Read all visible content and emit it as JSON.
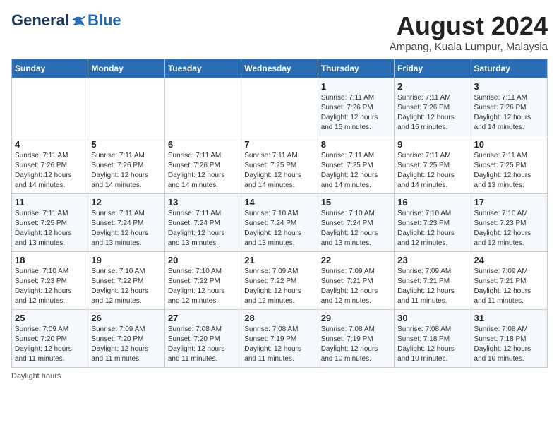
{
  "header": {
    "logo_general": "General",
    "logo_blue": "Blue",
    "month_year": "August 2024",
    "location": "Ampang, Kuala Lumpur, Malaysia"
  },
  "days_of_week": [
    "Sunday",
    "Monday",
    "Tuesday",
    "Wednesday",
    "Thursday",
    "Friday",
    "Saturday"
  ],
  "weeks": [
    [
      {
        "day": "",
        "info": ""
      },
      {
        "day": "",
        "info": ""
      },
      {
        "day": "",
        "info": ""
      },
      {
        "day": "",
        "info": ""
      },
      {
        "day": "1",
        "info": "Sunrise: 7:11 AM\nSunset: 7:26 PM\nDaylight: 12 hours\nand 15 minutes."
      },
      {
        "day": "2",
        "info": "Sunrise: 7:11 AM\nSunset: 7:26 PM\nDaylight: 12 hours\nand 15 minutes."
      },
      {
        "day": "3",
        "info": "Sunrise: 7:11 AM\nSunset: 7:26 PM\nDaylight: 12 hours\nand 14 minutes."
      }
    ],
    [
      {
        "day": "4",
        "info": "Sunrise: 7:11 AM\nSunset: 7:26 PM\nDaylight: 12 hours\nand 14 minutes."
      },
      {
        "day": "5",
        "info": "Sunrise: 7:11 AM\nSunset: 7:26 PM\nDaylight: 12 hours\nand 14 minutes."
      },
      {
        "day": "6",
        "info": "Sunrise: 7:11 AM\nSunset: 7:26 PM\nDaylight: 12 hours\nand 14 minutes."
      },
      {
        "day": "7",
        "info": "Sunrise: 7:11 AM\nSunset: 7:25 PM\nDaylight: 12 hours\nand 14 minutes."
      },
      {
        "day": "8",
        "info": "Sunrise: 7:11 AM\nSunset: 7:25 PM\nDaylight: 12 hours\nand 14 minutes."
      },
      {
        "day": "9",
        "info": "Sunrise: 7:11 AM\nSunset: 7:25 PM\nDaylight: 12 hours\nand 14 minutes."
      },
      {
        "day": "10",
        "info": "Sunrise: 7:11 AM\nSunset: 7:25 PM\nDaylight: 12 hours\nand 13 minutes."
      }
    ],
    [
      {
        "day": "11",
        "info": "Sunrise: 7:11 AM\nSunset: 7:25 PM\nDaylight: 12 hours\nand 13 minutes."
      },
      {
        "day": "12",
        "info": "Sunrise: 7:11 AM\nSunset: 7:24 PM\nDaylight: 12 hours\nand 13 minutes."
      },
      {
        "day": "13",
        "info": "Sunrise: 7:11 AM\nSunset: 7:24 PM\nDaylight: 12 hours\nand 13 minutes."
      },
      {
        "day": "14",
        "info": "Sunrise: 7:10 AM\nSunset: 7:24 PM\nDaylight: 12 hours\nand 13 minutes."
      },
      {
        "day": "15",
        "info": "Sunrise: 7:10 AM\nSunset: 7:24 PM\nDaylight: 12 hours\nand 13 minutes."
      },
      {
        "day": "16",
        "info": "Sunrise: 7:10 AM\nSunset: 7:23 PM\nDaylight: 12 hours\nand 12 minutes."
      },
      {
        "day": "17",
        "info": "Sunrise: 7:10 AM\nSunset: 7:23 PM\nDaylight: 12 hours\nand 12 minutes."
      }
    ],
    [
      {
        "day": "18",
        "info": "Sunrise: 7:10 AM\nSunset: 7:23 PM\nDaylight: 12 hours\nand 12 minutes."
      },
      {
        "day": "19",
        "info": "Sunrise: 7:10 AM\nSunset: 7:22 PM\nDaylight: 12 hours\nand 12 minutes."
      },
      {
        "day": "20",
        "info": "Sunrise: 7:10 AM\nSunset: 7:22 PM\nDaylight: 12 hours\nand 12 minutes."
      },
      {
        "day": "21",
        "info": "Sunrise: 7:09 AM\nSunset: 7:22 PM\nDaylight: 12 hours\nand 12 minutes."
      },
      {
        "day": "22",
        "info": "Sunrise: 7:09 AM\nSunset: 7:21 PM\nDaylight: 12 hours\nand 12 minutes."
      },
      {
        "day": "23",
        "info": "Sunrise: 7:09 AM\nSunset: 7:21 PM\nDaylight: 12 hours\nand 11 minutes."
      },
      {
        "day": "24",
        "info": "Sunrise: 7:09 AM\nSunset: 7:21 PM\nDaylight: 12 hours\nand 11 minutes."
      }
    ],
    [
      {
        "day": "25",
        "info": "Sunrise: 7:09 AM\nSunset: 7:20 PM\nDaylight: 12 hours\nand 11 minutes."
      },
      {
        "day": "26",
        "info": "Sunrise: 7:09 AM\nSunset: 7:20 PM\nDaylight: 12 hours\nand 11 minutes."
      },
      {
        "day": "27",
        "info": "Sunrise: 7:08 AM\nSunset: 7:20 PM\nDaylight: 12 hours\nand 11 minutes."
      },
      {
        "day": "28",
        "info": "Sunrise: 7:08 AM\nSunset: 7:19 PM\nDaylight: 12 hours\nand 11 minutes."
      },
      {
        "day": "29",
        "info": "Sunrise: 7:08 AM\nSunset: 7:19 PM\nDaylight: 12 hours\nand 10 minutes."
      },
      {
        "day": "30",
        "info": "Sunrise: 7:08 AM\nSunset: 7:18 PM\nDaylight: 12 hours\nand 10 minutes."
      },
      {
        "day": "31",
        "info": "Sunrise: 7:08 AM\nSunset: 7:18 PM\nDaylight: 12 hours\nand 10 minutes."
      }
    ]
  ],
  "footer": {
    "note": "Daylight hours"
  }
}
